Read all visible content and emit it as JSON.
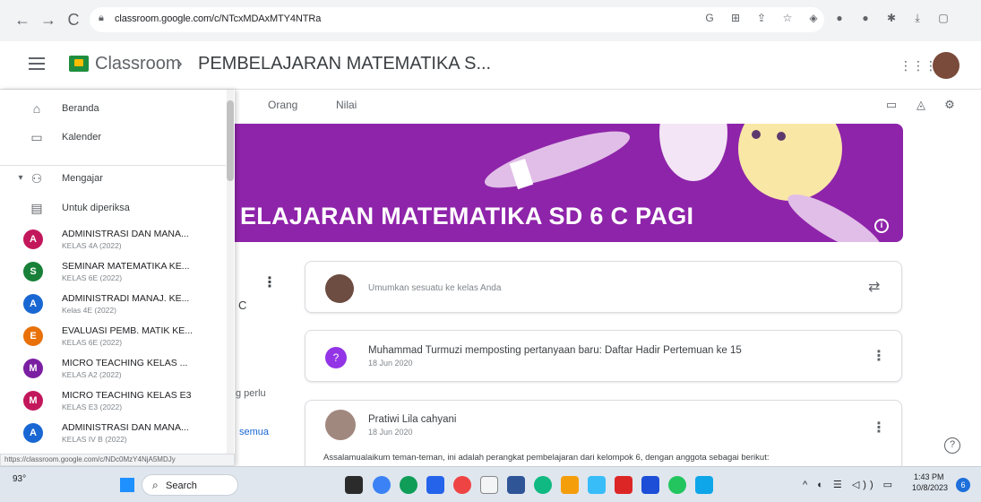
{
  "browser": {
    "url": "classroom.google.com/c/NTcxMDAxMTY4NTRa",
    "back": "←",
    "forward": "→",
    "reload": "C",
    "extensions": [
      {
        "name": "google-icon",
        "glyph": "G"
      },
      {
        "name": "translate-icon",
        "glyph": "⊞"
      },
      {
        "name": "share-icon",
        "glyph": "⇪"
      },
      {
        "name": "star-icon",
        "glyph": "☆"
      },
      {
        "name": "shield-icon",
        "glyph": "◈"
      },
      {
        "name": "extension-a-icon",
        "glyph": "●"
      },
      {
        "name": "extension-b-icon",
        "glyph": "●"
      },
      {
        "name": "puzzle-icon",
        "glyph": "✱"
      },
      {
        "name": "download-icon",
        "glyph": "⤓"
      },
      {
        "name": "sidepanel-icon",
        "glyph": "▢"
      }
    ]
  },
  "header": {
    "app_name": "Classroom",
    "separator": "›",
    "course_title": "PEMBELAJARAN MATEMATIKA S..."
  },
  "tabs": [
    {
      "label": "Orang"
    },
    {
      "label": "Nilai"
    }
  ],
  "banner": {
    "title": "ELAJARAN MATEMATIKA SD 6 C PAGI",
    "info": "i",
    "color": "#8e24aa"
  },
  "drawer": {
    "nav": [
      {
        "label": "Beranda",
        "icon": "home-icon"
      },
      {
        "label": "Kalender",
        "icon": "calendar-icon"
      },
      {
        "label": "Mengajar",
        "icon": "people-icon"
      },
      {
        "label": "Untuk diperiksa",
        "icon": "inbox-icon"
      }
    ],
    "courses": [
      {
        "initial": "A",
        "name": "ADMINISTRASI DAN MANA...",
        "section": "KELAS 4A (2022)",
        "color": "#c2185b"
      },
      {
        "initial": "S",
        "name": "SEMINAR MATEMATIKA KE...",
        "section": "KELAS 6E (2022)",
        "color": "#188038"
      },
      {
        "initial": "A",
        "name": "ADMINISTRADI MANAJ. KE...",
        "section": "Kelas 4E (2022)",
        "color": "#1967d2"
      },
      {
        "initial": "E",
        "name": "EVALUASI PEMB. MATIK KE...",
        "section": "KELAS 6E (2022)",
        "color": "#e8710a"
      },
      {
        "initial": "M",
        "name": "MICRO TEACHING KELAS ...",
        "section": "KELAS A2 (2022)",
        "color": "#7b1fa2"
      },
      {
        "initial": "M",
        "name": "MICRO TEACHING KELAS E3",
        "section": "KELAS E3 (2022)",
        "color": "#c2185b"
      },
      {
        "initial": "A",
        "name": "ADMINISTRASI DAN MANA...",
        "section": "KELAS IV B (2022)",
        "color": "#1967d2"
      }
    ]
  },
  "left_remnants": {
    "perlu": "g perlu",
    "semua": "semua",
    "c": "C"
  },
  "stream": {
    "announce_placeholder": "Umumkan sesuatu ke kelas Anda",
    "post1_title": "Muhammad Turmuzi memposting pertanyaan baru: Daftar Hadir Pertemuan ke 15",
    "post1_date": "18 Jun 2020",
    "post2_author": "Pratiwi Lila cahyani",
    "post2_date": "18 Jun 2020",
    "post2_body": "Assalamualaikum teman-teman, ini adalah perangkat pembelajaran dari kelompok 6, dengan anggota sebagai berikut:"
  },
  "status_url": "https://classroom.google.com/c/NDc0MzY4NjA5MDJy",
  "taskbar": {
    "weather": "93°",
    "search_label": "Search",
    "time": "1:43 PM",
    "date": "10/8/2023",
    "tray": "^ ◐ ☰ ◁)) ▭",
    "notifications": "6"
  }
}
